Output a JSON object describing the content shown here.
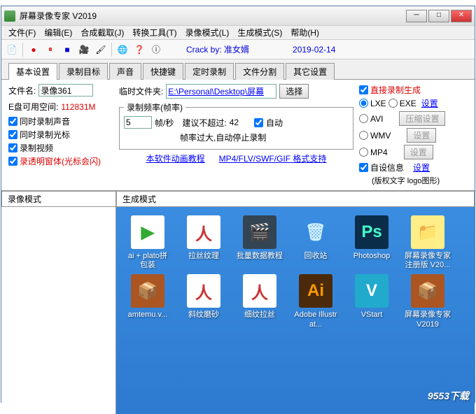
{
  "window": {
    "title": "屏幕录像专家 V2019"
  },
  "menu": [
    "文件(F)",
    "编辑(E)",
    "合成截取(J)",
    "转换工具(T)",
    "录像模式(L)",
    "生成模式(S)",
    "帮助(H)"
  ],
  "toolbar": {
    "crack": "Crack by: 准女婿",
    "date": "2019-02-14"
  },
  "tabs": [
    "基本设置",
    "录制目标",
    "声音",
    "快捷键",
    "定时录制",
    "文件分割",
    "其它设置"
  ],
  "filename": {
    "label": "文件名:",
    "value": "录像361"
  },
  "tempdir": {
    "label": "临时文件夹:",
    "value": "E:\\Personal\\Desktop\\屏幕",
    "select": "选择"
  },
  "disk": {
    "label": "E盘可用空间:",
    "value": "112831M"
  },
  "checks": {
    "sound": "同时录制声音",
    "cursor": "同时录制光标",
    "video": "录制视频",
    "transp": "录透明窗体(光标会闪)"
  },
  "fps": {
    "legend": "录制频率(帧率)",
    "value": "5",
    "unit": "帧/秒",
    "recommend": "建议不超过:",
    "max": "42",
    "auto": "自动",
    "note": "帧率过大,自动停止录制"
  },
  "links": {
    "tutorial": "本软件动画教程",
    "formats": "MP4/FLV/SWF/GIF 格式支持"
  },
  "output": {
    "direct": "直接录制生成",
    "lxe": "LXE",
    "exe": "EXE",
    "settings": "设置",
    "avi": "AVI",
    "compress": "压缩设置",
    "wmv": "WMV",
    "mp4": "MP4",
    "custom": "自设信息",
    "customset": "设置",
    "note": "(版权文字 logo图形)"
  },
  "modes": {
    "rec": "录像模式",
    "gen": "生成模式"
  },
  "desktop_icons": [
    {
      "label": "ai + plato拼包装",
      "bg": "#fff",
      "fg": "#3a3",
      "glyph": "▶"
    },
    {
      "label": "拉丝纹理",
      "bg": "#fff",
      "fg": "#c33",
      "glyph": "人"
    },
    {
      "label": "批量数据教程",
      "bg": "#345",
      "fg": "#fc6",
      "glyph": "🎬"
    },
    {
      "label": "回收站",
      "bg": "transparent",
      "fg": "#cef",
      "glyph": "🗑"
    },
    {
      "label": "Photoshop",
      "bg": "#0a2d4a",
      "fg": "#4fc",
      "glyph": "Ps"
    },
    {
      "label": "屏幕录像专家注册版 V20...",
      "bg": "#fe8",
      "fg": "#ca5",
      "glyph": "📁"
    },
    {
      "label": "amtemu.v...",
      "bg": "#a52",
      "fg": "#fc8",
      "glyph": "📦"
    },
    {
      "label": "斜纹磨砂",
      "bg": "#fff",
      "fg": "#c33",
      "glyph": "人"
    },
    {
      "label": "细纹拉丝",
      "bg": "#fff",
      "fg": "#c33",
      "glyph": "人"
    },
    {
      "label": "Adobe Illustrat...",
      "bg": "#4a2a0a",
      "fg": "#f90",
      "glyph": "Ai"
    },
    {
      "label": "VStart",
      "bg": "#2ac",
      "fg": "#fff",
      "glyph": "V"
    },
    {
      "label": "屏幕录像专家V2019",
      "bg": "#a52",
      "fg": "#fc8",
      "glyph": "📦"
    }
  ],
  "watermark": "9553下载"
}
